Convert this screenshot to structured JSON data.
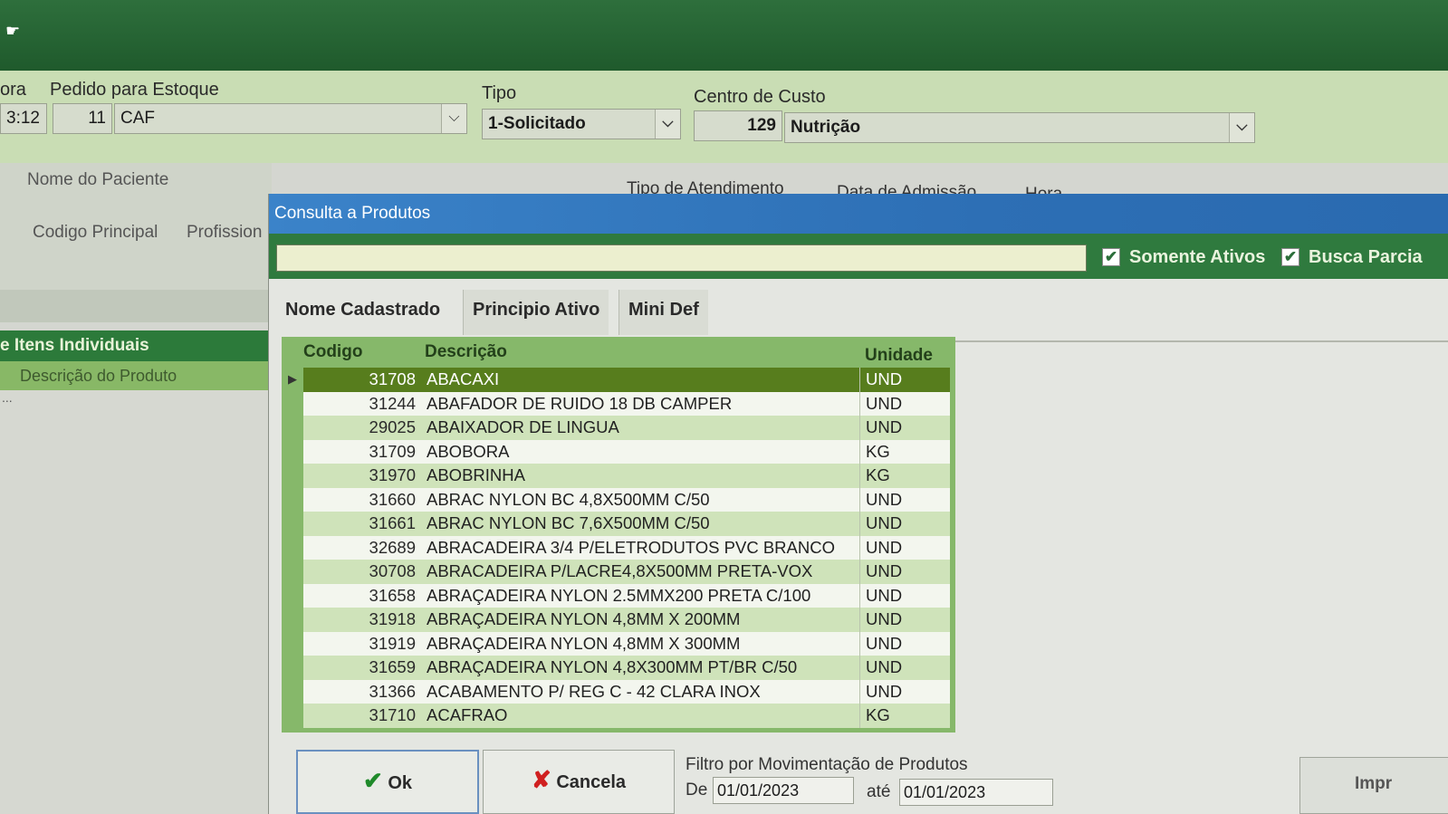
{
  "header": {
    "hora_label": "ora",
    "hora_value": "3:12",
    "pedido_label": "Pedido para Estoque",
    "pedido_num": "11",
    "pedido_value": "CAF",
    "tipo_label": "Tipo",
    "tipo_value": "1-Solicitado",
    "centro_label": "Centro de Custo",
    "centro_num": "129",
    "centro_value": "Nutrição"
  },
  "patient": {
    "nome_label": "Nome do Paciente",
    "tipo_atend_label": "Tipo de Atendimento",
    "data_adm_label": "Data de Admissão",
    "hora_label": "Hora",
    "codigo_label": "Codigo Principal",
    "profissional_label": "Profission"
  },
  "items": {
    "header": "e Itens Individuais",
    "column": "Descrição do Produto",
    "ellipsis": "..."
  },
  "dialog": {
    "title": "Consulta a Produtos",
    "search_value": "",
    "somente_ativos_label": "Somente Ativos",
    "busca_parcial_label": "Busca Parcia",
    "check_glyph": "✔",
    "tabs": [
      "Nome Cadastrado",
      "Principio Ativo",
      "Mini Def"
    ],
    "columns": {
      "codigo": "Codigo",
      "descricao": "Descrição",
      "unidade": "Unidade"
    },
    "rows": [
      {
        "codigo": "31708",
        "descricao": "ABACAXI",
        "unidade": "UND",
        "selected": true
      },
      {
        "codigo": "31244",
        "descricao": "ABAFADOR DE RUIDO 18 DB CAMPER",
        "unidade": "UND"
      },
      {
        "codigo": "29025",
        "descricao": "ABAIXADOR DE LINGUA",
        "unidade": "UND"
      },
      {
        "codigo": "31709",
        "descricao": "ABOBORA",
        "unidade": "KG"
      },
      {
        "codigo": "31970",
        "descricao": "ABOBRINHA",
        "unidade": "KG"
      },
      {
        "codigo": "31660",
        "descricao": "ABRAC NYLON BC 4,8X500MM C/50",
        "unidade": "UND"
      },
      {
        "codigo": "31661",
        "descricao": "ABRAC NYLON BC 7,6X500MM C/50",
        "unidade": "UND"
      },
      {
        "codigo": "32689",
        "descricao": "ABRACADEIRA 3/4 P/ELETRODUTOS PVC BRANCO",
        "unidade": "UND"
      },
      {
        "codigo": "30708",
        "descricao": "ABRACADEIRA P/LACRE4,8X500MM PRETA-VOX",
        "unidade": "UND"
      },
      {
        "codigo": "31658",
        "descricao": "ABRAÇADEIRA NYLON 2.5MMX200 PRETA C/100",
        "unidade": "UND"
      },
      {
        "codigo": "31918",
        "descricao": "ABRAÇADEIRA NYLON 4,8MM X 200MM",
        "unidade": "UND"
      },
      {
        "codigo": "31919",
        "descricao": "ABRAÇADEIRA NYLON 4,8MM X 300MM",
        "unidade": "UND"
      },
      {
        "codigo": "31659",
        "descricao": "ABRAÇADEIRA NYLON 4,8X300MM PT/BR C/50",
        "unidade": "UND"
      },
      {
        "codigo": "31366",
        "descricao": "ACABAMENTO P/ REG C - 42 CLARA INOX",
        "unidade": "UND"
      },
      {
        "codigo": "31710",
        "descricao": "ACAFRAO",
        "unidade": "KG"
      }
    ],
    "ok_label": "Ok",
    "cancel_label": "Cancela",
    "filtro_label": "Filtro por Movimentação de Produtos",
    "de_label": "De",
    "de_value": "01/01/2023",
    "ate_label": "até",
    "ate_value": "01/01/2023",
    "print_label": "Impr"
  },
  "colors": {
    "topbar": "#2e6f3c",
    "dialog_title": "#2d6fb5",
    "selected_row": "#577d1d",
    "alt_row": "#cfe3ba"
  }
}
